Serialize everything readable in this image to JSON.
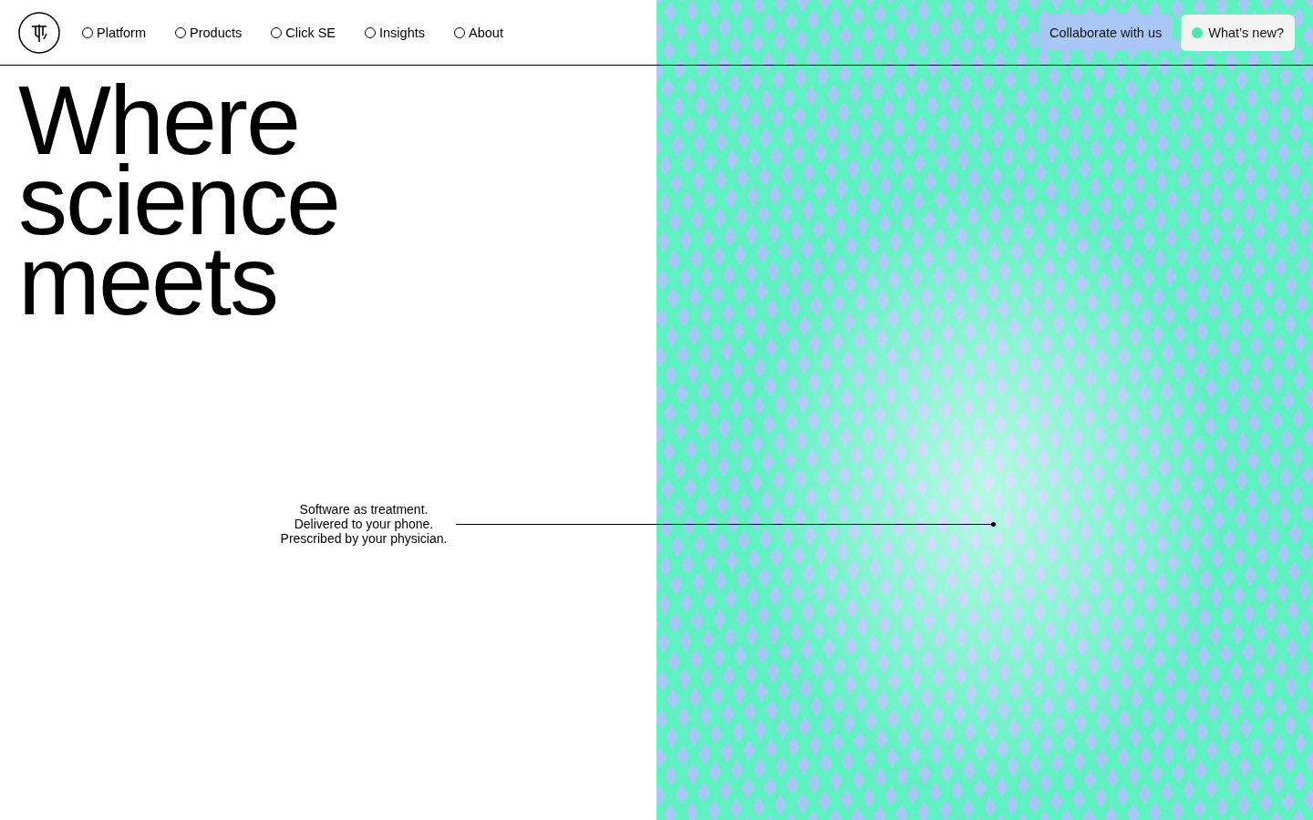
{
  "nav": {
    "items": [
      {
        "label": "Platform"
      },
      {
        "label": "Products"
      },
      {
        "label": "Click SE"
      },
      {
        "label": "Insights"
      },
      {
        "label": "About"
      }
    ]
  },
  "actions": [
    {
      "kind": "plain",
      "label": "Collaborate with us"
    },
    {
      "kind": "dot",
      "label": "What’s new?",
      "color": "#4ee6b0"
    }
  ],
  "hero": {
    "headline": "Where science meets",
    "caption": [
      "Software as treatment.",
      "Delivered to your phone.",
      "Prescribed by your physician."
    ]
  }
}
